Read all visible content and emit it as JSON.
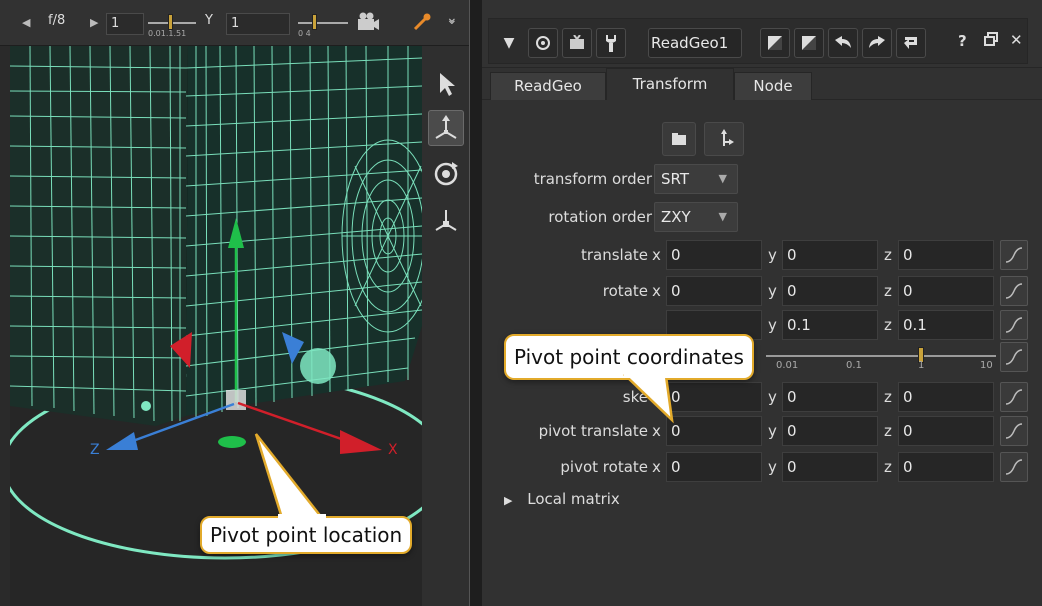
{
  "viewer": {
    "toolbar": {
      "prev_icon": "caret-left-icon",
      "fstop": "f/8",
      "next_icon": "caret-right-icon",
      "frame_value": "1",
      "slider1_ticks": "0.01.1.51",
      "y_label": "Y",
      "y_value": "1",
      "slider2_ticks": "0            4",
      "camera_icon": "camera-icon",
      "picker_icon": "color-picker-icon",
      "more_icon": "double-chevron-icon"
    },
    "side_tools": [
      "select-arrow-icon",
      "transform-axis-icon",
      "rotate-icon",
      "pivot-axis-icon"
    ],
    "axis_labels": {
      "x": "X",
      "z": "Z"
    },
    "colors": {
      "mesh": "#7fe8c2",
      "x_axis": "#d11f2a",
      "y_axis": "#1fbf4a",
      "z_axis": "#3a7fd6"
    }
  },
  "panel": {
    "toolbar": {
      "collapse_icon": "triangle-down-icon",
      "center_icon": "center-node-icon",
      "input_icon": "input-arrow-icon",
      "settings_icon": "wrench-icon",
      "node_name": "ReadGeo1",
      "color1_icon": "color-swatch-icon",
      "color2_icon": "color-swatch-icon",
      "undo_icon": "undo-icon",
      "redo_icon": "redo-icon",
      "revert_icon": "revert-icon",
      "help": "?",
      "float_icon": "float-window-icon",
      "close": "✕"
    },
    "tabs": [
      {
        "label": "ReadGeo",
        "selected": false
      },
      {
        "label": "Transform",
        "selected": true
      },
      {
        "label": "Node",
        "selected": false
      }
    ],
    "icon_buttons": [
      "folder-icon",
      "axis-move-icon"
    ],
    "transform_order": {
      "label": "transform order",
      "value": "SRT"
    },
    "rotation_order": {
      "label": "rotation order",
      "value": "ZXY"
    },
    "translate": {
      "label": "translate",
      "x": "0",
      "y": "0",
      "z": "0"
    },
    "rotate": {
      "label": "rotate",
      "x": "0",
      "y": "0",
      "z": "0"
    },
    "scale": {
      "y": "0.1",
      "z": "0.1"
    },
    "uniform_scale_ticks": [
      "0.01",
      "0.1",
      "1",
      "10"
    ],
    "uniform_scale_value": 1,
    "skew": {
      "label": "ske",
      "x": "0",
      "y": "0",
      "z": "0"
    },
    "pivot_translate": {
      "label": "pivot translate",
      "x": "0",
      "y": "0",
      "z": "0"
    },
    "pivot_rotate": {
      "label": "pivot rotate",
      "x": "0",
      "y": "0",
      "z": "0"
    },
    "axis_names": {
      "x": "x",
      "y": "y",
      "z": "z"
    },
    "local_matrix": "Local matrix"
  },
  "callouts": {
    "coordinates": "Pivot point coordinates",
    "location": "Pivot point location"
  }
}
